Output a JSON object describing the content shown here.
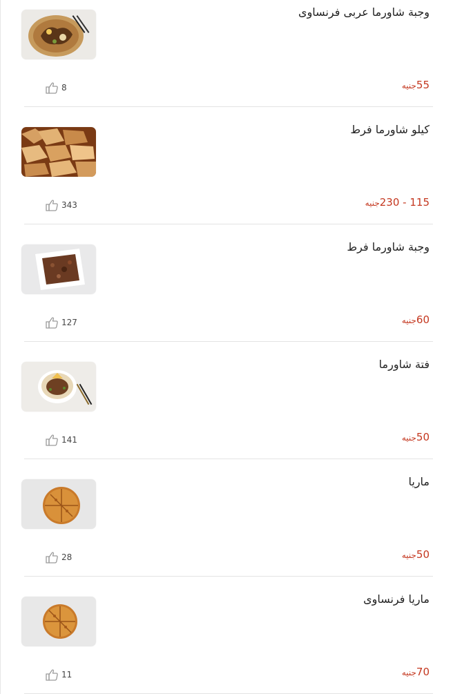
{
  "currency_label": "جنيه",
  "items": [
    {
      "title": "وجبة شاورما عربى فرنساوى",
      "price": "55",
      "likes": "8",
      "image": "shawarma-platter"
    },
    {
      "title": "كيلو شاورما فرط",
      "price": "115 - 230",
      "likes": "343",
      "image": "shawarma-pile"
    },
    {
      "title": "وجبة شاورما فرط",
      "price": "60",
      "likes": "127",
      "image": "shawarma-plate"
    },
    {
      "title": "فتة شاورما",
      "price": "50",
      "likes": "141",
      "image": "fattah-bowl"
    },
    {
      "title": "ماريا",
      "price": "50",
      "likes": "28",
      "image": "maria-bread"
    },
    {
      "title": "ماريا فرنساوى",
      "price": "70",
      "likes": "11",
      "image": "maria-bread"
    }
  ],
  "colors": {
    "price": "#c4371f",
    "title": "#222222",
    "separator": "#e3e3e3",
    "like_icon": "#9a9a9a"
  }
}
